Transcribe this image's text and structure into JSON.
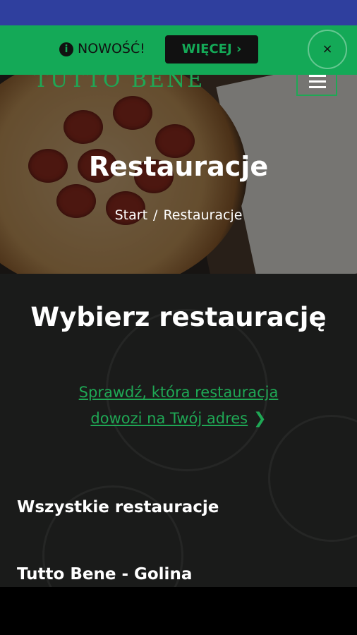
{
  "banner": {
    "info_icon": "i",
    "news_label": "NOWOŚĆ!",
    "more_button": "WIĘCEJ ›",
    "close_label": "×",
    "background_color": "#14a957"
  },
  "hero": {
    "logo_text": "TUTTO BENE",
    "title": "Restauracje",
    "breadcrumb": {
      "home": "Start",
      "separator": "/",
      "current": "Restauracje"
    }
  },
  "main": {
    "heading": "Wybierz restaurację",
    "check_link_line1": "Sprawdź, która restauracja",
    "check_link_line2": "dowozi na Twój adres",
    "check_link_icon": "chevron-right-icon",
    "all_restaurants_label": "Wszystkie restauracje",
    "restaurants": [
      {
        "name": "Tutto Bene - Golina"
      }
    ],
    "accent_color": "#1fa855"
  }
}
